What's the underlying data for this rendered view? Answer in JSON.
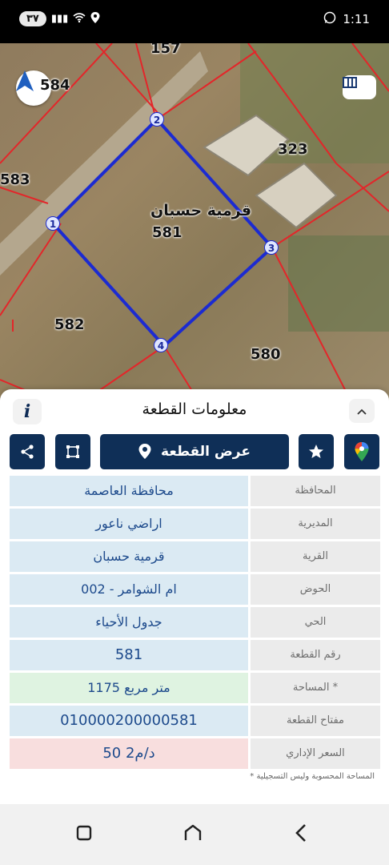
{
  "status_bar": {
    "left_pill": "٣٧",
    "time": "1:11",
    "icons": [
      "signal-icon",
      "wifi-icon",
      "location-icon",
      "whatsapp-icon"
    ]
  },
  "map": {
    "parcel_numbers": {
      "p157": "157",
      "p584": "584",
      "p583": "583",
      "p323": "323",
      "p582": "582",
      "p580": "580"
    },
    "parcel_name": "قرمية حسبان",
    "parcel_id": "581",
    "vertices": [
      "1",
      "2",
      "3",
      "4"
    ],
    "boundary_color": "#1c2bd1",
    "neighbor_line_color": "#e3262a"
  },
  "panel": {
    "title": "معلومات القطعة",
    "info_glyph": "i",
    "collapse_glyph": "⌃",
    "view_button_label": "عرض القطعة",
    "rows": [
      {
        "label": "المحافظة",
        "value": "محافظة العاصمة"
      },
      {
        "label": "المديرية",
        "value": "اراضي ناعور"
      },
      {
        "label": "القرية",
        "value": "قرمية حسبان"
      },
      {
        "label": "الحوض",
        "value": "ام الشوامر - 002"
      },
      {
        "label": "الحي",
        "value": "جدول الأحياء"
      },
      {
        "label": "رقم القطعة",
        "value": "581"
      },
      {
        "label": "المساحة *",
        "value": "1175  متر مربع"
      },
      {
        "label": "مفتاح القطعة",
        "value": "010000200000581"
      },
      {
        "label": "السعر الإداري",
        "value": "50 د/م2"
      }
    ],
    "footnote": "* المساحة المحسوبة وليس التسجيلية"
  },
  "colors": {
    "primary": "#0f2f57",
    "value_bg": "#dbeaf3",
    "area_bg": "#dff3e1",
    "price_bg": "#f8dede",
    "label_bg": "#ebebeb"
  }
}
